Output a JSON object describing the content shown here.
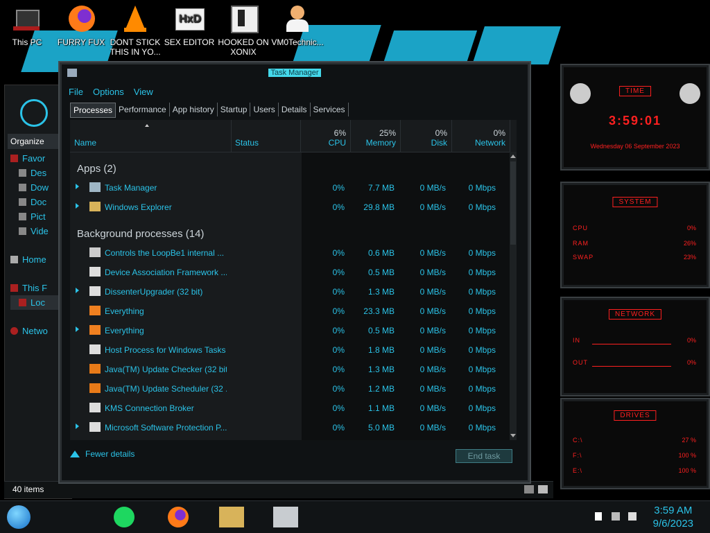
{
  "desktop": {
    "icons": [
      {
        "label": "This PC"
      },
      {
        "label": "FURRY FUX"
      },
      {
        "label": "DONT STICK THIS IN YO..."
      },
      {
        "label": "SEX EDITOR"
      },
      {
        "label": "HOOKED ON XONIX"
      },
      {
        "label": "VM0Technic..."
      }
    ]
  },
  "explorer": {
    "organize_label": "Organize",
    "nav": [
      {
        "label": "Favor"
      },
      {
        "label": "Des"
      },
      {
        "label": "Dow"
      },
      {
        "label": "Doc"
      },
      {
        "label": "Pict"
      },
      {
        "label": "Vide"
      },
      {
        "label": "Home"
      },
      {
        "label": "This F"
      },
      {
        "label": "Loc"
      },
      {
        "label": "Netwo"
      }
    ],
    "status": "40 items"
  },
  "taskmanager": {
    "title": "Task Manager",
    "menu": [
      "File",
      "Options",
      "View"
    ],
    "tabs": [
      "Processes",
      "Performance",
      "App history",
      "Startup",
      "Users",
      "Details",
      "Services"
    ],
    "columns": {
      "name": "Name",
      "status": "Status",
      "cpu": {
        "pct": "6%",
        "label": "CPU"
      },
      "memory": {
        "pct": "25%",
        "label": "Memory"
      },
      "disk": {
        "pct": "0%",
        "label": "Disk"
      },
      "network": {
        "pct": "0%",
        "label": "Network"
      }
    },
    "groups": {
      "apps": "Apps (2)",
      "background": "Background processes (14)"
    },
    "apps": [
      {
        "name": "Task Manager",
        "cpu": "0%",
        "mem": "7.7 MB",
        "disk": "0 MB/s",
        "net": "0 Mbps"
      },
      {
        "name": "Windows Explorer",
        "cpu": "0%",
        "mem": "29.8 MB",
        "disk": "0 MB/s",
        "net": "0 Mbps"
      }
    ],
    "background": [
      {
        "name": "Controls the LoopBe1 internal ...",
        "cpu": "0%",
        "mem": "0.6 MB",
        "disk": "0 MB/s",
        "net": "0 Mbps"
      },
      {
        "name": "Device Association Framework ...",
        "cpu": "0%",
        "mem": "0.5 MB",
        "disk": "0 MB/s",
        "net": "0 Mbps"
      },
      {
        "name": "DissenterUpgrader (32 bit)",
        "cpu": "0%",
        "mem": "1.3 MB",
        "disk": "0 MB/s",
        "net": "0 Mbps"
      },
      {
        "name": "Everything",
        "cpu": "0%",
        "mem": "23.3 MB",
        "disk": "0 MB/s",
        "net": "0 Mbps"
      },
      {
        "name": "Everything",
        "cpu": "0%",
        "mem": "0.5 MB",
        "disk": "0 MB/s",
        "net": "0 Mbps"
      },
      {
        "name": "Host Process for Windows Tasks",
        "cpu": "0%",
        "mem": "1.8 MB",
        "disk": "0 MB/s",
        "net": "0 Mbps"
      },
      {
        "name": "Java(TM) Update Checker (32 bit)",
        "cpu": "0%",
        "mem": "1.3 MB",
        "disk": "0 MB/s",
        "net": "0 Mbps"
      },
      {
        "name": "Java(TM) Update Scheduler (32 ...",
        "cpu": "0%",
        "mem": "1.2 MB",
        "disk": "0 MB/s",
        "net": "0 Mbps"
      },
      {
        "name": "KMS Connection Broker",
        "cpu": "0%",
        "mem": "1.1 MB",
        "disk": "0 MB/s",
        "net": "0 Mbps"
      },
      {
        "name": "Microsoft Software Protection P...",
        "cpu": "0%",
        "mem": "5.0 MB",
        "disk": "0 MB/s",
        "net": "0 Mbps"
      }
    ],
    "fewer_details": "Fewer details",
    "end_task": "End task"
  },
  "gadgets": {
    "time": {
      "title": "TIME",
      "clock": "3:59:01",
      "date": "Wednesday 06 September 2023"
    },
    "system": {
      "title": "SYSTEM",
      "cpu_label": "CPU",
      "cpu": "0%",
      "ram_label": "RAM",
      "ram": "26%",
      "swap_label": "SWAP",
      "swap": "23%"
    },
    "network": {
      "title": "NETWORK",
      "in_label": "IN",
      "in": "0%",
      "out_label": "OUT",
      "out": "0%"
    },
    "drives": {
      "title": "DRIVES",
      "c_label": "C:\\",
      "c": "27 %",
      "f_label": "F:\\",
      "f": "100 %",
      "e_label": "E:\\",
      "e": "100 %"
    }
  },
  "taskbar": {
    "time": "3:59 AM",
    "date": "9/6/2023"
  },
  "colors": {
    "accent": "#2bc3e8",
    "gadget_red": "#ff2020",
    "wallpaper": "#1ba3c6"
  }
}
